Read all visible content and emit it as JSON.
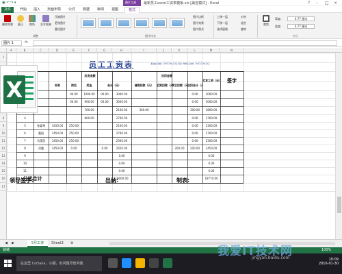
{
  "app": {
    "window_title": "最新员工excel工资表模板.xls [兼容模式] - Excel",
    "contextual_tab": "图片工具"
  },
  "tabs": [
    "文件",
    "开始",
    "插入",
    "页面布局",
    "公式",
    "数据",
    "审阅",
    "视图",
    "格式"
  ],
  "ribbon": {
    "adjust_group": [
      "删除背景",
      "更正",
      "颜色",
      "艺术效果"
    ],
    "adjust_small": [
      "压缩图片",
      "更改图片",
      "重设图片"
    ],
    "adjust_label": "调整",
    "styles_label": "图片样式",
    "style_options": [
      "图片边框",
      "图片效果",
      "图片版式"
    ],
    "arrange_options": [
      "上移一层",
      "下移一层",
      "选择窗格"
    ],
    "arrange_options2": [
      "对齐",
      "组合",
      "旋转"
    ],
    "size_label": "大小",
    "height_label": "高度:",
    "height_value": "6.77 厘米",
    "width_label": "宽度:",
    "width_value": "6.77 厘米",
    "crop": "裁剪"
  },
  "formula_bar": {
    "name_box": "图片 1",
    "fx": "fx",
    "content": ""
  },
  "columns": [
    "A",
    "B",
    "C",
    "D",
    "E",
    "F",
    "G",
    "H",
    "I",
    "J",
    "K",
    "L",
    "M",
    "N"
  ],
  "rows": [
    "1",
    "2",
    "3",
    "4",
    "5",
    "6",
    "7",
    "8",
    "9",
    "10",
    "11",
    "12",
    "13",
    "14",
    "15",
    "16",
    "17"
  ],
  "sheet": {
    "title": "员工工资表",
    "date_info": "发放日期: 2015年2月1日  所属月份: 2015年1月",
    "group_should": "应发金额",
    "group_deduct": "应扣金额",
    "headers": {
      "base": "基本",
      "subsidy": "补助",
      "post": "岗位",
      "bonus": "奖金",
      "total_should": "合计（元）",
      "leave": "请假扣款（元）",
      "late": "迟到扣款（元）",
      "other": "其它扣款（元）",
      "total_deduct": "应扣合计（元）",
      "actual": "实发工资（元）",
      "sign": "签字"
    },
    "employees": [
      {
        "name": "",
        "base": "",
        "subsidy": "00.00",
        "post": "1000.00",
        "bonus": "00.00",
        "total": "3000.00",
        "leave": "",
        "late": "",
        "other": "",
        "deduct": "0.00",
        "actual": "3000.00"
      },
      {
        "name": "",
        "base": "",
        "subsidy": "00.00",
        "post": "900.00",
        "bonus": "00.00",
        "total": "3000.00",
        "leave": "",
        "late": "",
        "other": "",
        "deduct": "0.00",
        "actual": "3000.00"
      },
      {
        "name": "",
        "base": "",
        "subsidy": "",
        "post": "700.00",
        "bonus": "",
        "total": "2100.00",
        "leave": "300.00",
        "late": "",
        "other": "",
        "deduct": "300.00",
        "actual": "1800.00"
      },
      {
        "name": "",
        "base": "",
        "subsidy": "",
        "post": "800.00",
        "bonus": "",
        "total": "2700.00",
        "leave": "",
        "late": "",
        "other": "",
        "deduct": "0.00",
        "actual": "2700.00"
      },
      {
        "name": "张爱琴",
        "base": "1450.00",
        "subsidy": "250.00",
        "post": "",
        "bonus": "",
        "total": "2100.00",
        "leave": "",
        "late": "",
        "other": "",
        "deduct": "0.00",
        "actual": "2100.00"
      },
      {
        "name": "嘉阳",
        "base": "1450.00",
        "subsidy": "250.00",
        "post": "",
        "bonus": "",
        "total": "2700.00",
        "leave": "",
        "late": "",
        "other": "",
        "deduct": "0.00",
        "actual": "2700.00"
      },
      {
        "name": "马莲莲",
        "base": "1450.00",
        "subsidy": "250.00",
        "post": "",
        "bonus": "",
        "total": "2300.00",
        "leave": "",
        "late": "",
        "other": "",
        "deduct": "0.00",
        "actual": "2300.00"
      },
      {
        "name": "邓霞",
        "base": "1450.00",
        "subsidy": "0.00",
        "post": "",
        "bonus": "0.00",
        "total": "1650.00",
        "leave": "",
        "late": "",
        "other": "200.00",
        "deduct": "200.00",
        "actual": "1450.00"
      }
    ],
    "empty_totals": [
      "0.00",
      "0.00",
      "0.00"
    ],
    "empty_actual": [
      "0.00",
      "0.00",
      "0.00"
    ],
    "subtotal_label": "分栏合计",
    "subtotal_total": "19000.00",
    "subtotal_actual": "18770.00",
    "row_numbers": [
      "1",
      "2",
      "3",
      "4",
      "5",
      "6",
      "7",
      "8",
      "9",
      "10",
      "11"
    ]
  },
  "signatures": {
    "leader": "领导签字:",
    "cashier": "出纳:",
    "preparer": "制表:"
  },
  "sheet_tabs": [
    "5月工资",
    "Sheet3"
  ],
  "status": {
    "ready": "就绪",
    "zoom": "100%"
  },
  "taskbar": {
    "search_placeholder": "在这里 Cortana，小娜，有问题尽管问我",
    "time": "10:09",
    "date": "2016-01-30"
  },
  "watermark": {
    "text": "我爱IT技术网",
    "url": "jingyan.baidu.com"
  },
  "colors": {
    "excel_green": "#217346",
    "title_blue": "#1f3f8f",
    "context_purple": "#7b3fa0"
  }
}
